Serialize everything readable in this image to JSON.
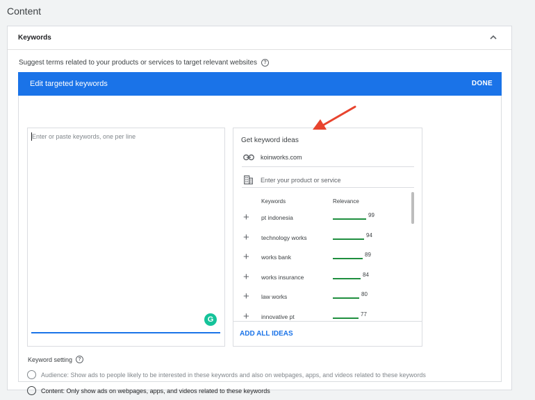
{
  "page": {
    "title": "Content"
  },
  "card": {
    "title": "Keywords",
    "suggest_text": "Suggest terms related to your products or services to target relevant websites",
    "help_glyph": "?"
  },
  "editor": {
    "bar_title": "Edit targeted keywords",
    "done_label": "DONE",
    "keywords_placeholder": "Enter or paste keywords, one per line",
    "grammarly_glyph": "G"
  },
  "ideas": {
    "title": "Get keyword ideas",
    "url_value": "koinworks.com",
    "product_placeholder": "Enter your product or service",
    "col_keywords": "Keywords",
    "col_relevance": "Relevance",
    "rows": [
      {
        "keyword": "pt indonesia",
        "relevance": 99
      },
      {
        "keyword": "technology works",
        "relevance": 94
      },
      {
        "keyword": "works bank",
        "relevance": 89
      },
      {
        "keyword": "works insurance",
        "relevance": 84
      },
      {
        "keyword": "law works",
        "relevance": 80
      },
      {
        "keyword": "innovative pt",
        "relevance": 77
      }
    ],
    "add_all_label": "ADD ALL IDEAS",
    "plus_glyph": "+"
  },
  "keyword_setting": {
    "label": "Keyword setting",
    "options": [
      {
        "label": "Audience: Show ads to people likely to be interested in these keywords and also on webpages, apps, and videos related to these keywords"
      },
      {
        "label": "Content: Only show ads on webpages, apps, and videos related to these keywords"
      }
    ]
  },
  "colors": {
    "accent": "#1a73e8",
    "relevance_bar": "#1e8e3e",
    "annotation_arrow": "#e8442e"
  },
  "icons": {
    "collapse": "chevron-up-icon",
    "help": "help-circle-icon",
    "url": "link-icon",
    "product": "building-icon",
    "add": "plus-icon",
    "grammarly": "grammarly-icon"
  }
}
